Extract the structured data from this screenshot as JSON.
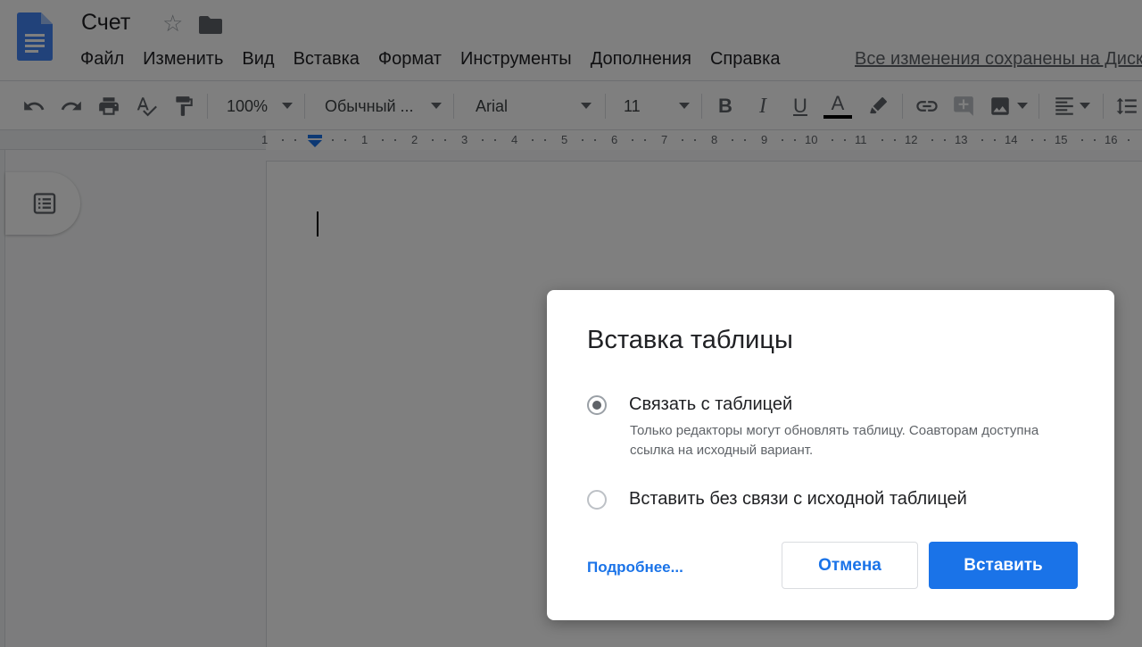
{
  "header": {
    "doc_title": "Счет",
    "saved_status": "Все изменения сохранены на Диске",
    "menu": [
      "Файл",
      "Изменить",
      "Вид",
      "Вставка",
      "Формат",
      "Инструменты",
      "Дополнения",
      "Справка"
    ]
  },
  "toolbar": {
    "zoom": "100%",
    "style": "Обычный ...",
    "font": "Arial",
    "font_size": "11",
    "text_color_glyph": "A"
  },
  "ruler": {
    "numbers": [
      "1",
      "1",
      "2",
      "3",
      "4",
      "5",
      "6",
      "7",
      "8",
      "9",
      "10",
      "11",
      "12",
      "13",
      "14",
      "15",
      "16"
    ]
  },
  "dialog": {
    "title": "Вставка таблицы",
    "option_link": {
      "label": "Связать с таблицей",
      "description": "Только редакторы могут обновлять таблицу. Соавторам доступна ссылка на исходный вариант.",
      "selected": true
    },
    "option_unlink": {
      "label": "Вставить без связи с исходной таблицей",
      "selected": false
    },
    "more_link": "Подробнее...",
    "cancel_label": "Отмена",
    "insert_label": "Вставить"
  },
  "colors": {
    "accent": "#1a73e8",
    "docs_blue": "#4285f4",
    "overlay": "rgba(0,0,0,0.5)"
  }
}
